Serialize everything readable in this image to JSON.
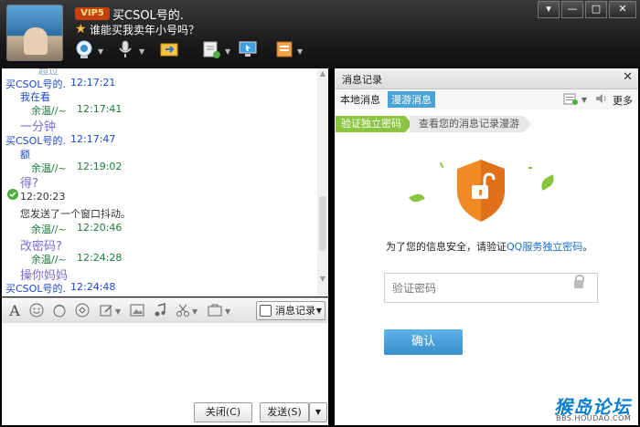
{
  "header": {
    "vip_badge": "VIP5",
    "nickname": "买CSOL号的.",
    "signature": "谁能买我卖年小号吗？"
  },
  "toolbar": {
    "icons": [
      "video-call-icon",
      "voice-call-icon",
      "file-transfer-icon",
      "message-icon",
      "remote-assist-icon",
      "app-box-icon"
    ]
  },
  "window_controls": {
    "menu": "▾",
    "minimize": "—",
    "maximize": "□",
    "close": "✕"
  },
  "chat": {
    "messages": [
      {
        "sender": "买CSOL号的.",
        "time": "12:17:21",
        "text": "我在看"
      },
      {
        "sender": "余温//~",
        "time": "12:17:41",
        "text": "一分钟"
      },
      {
        "sender": "买CSOL号的.",
        "time": "12:17:47",
        "text": "额"
      },
      {
        "sender": "余温//~",
        "time": "12:19:02",
        "text": "得?"
      },
      {
        "system_time": "12:20:23",
        "system_text": "您发送了一个窗口抖动。"
      },
      {
        "sender": "余温//~",
        "time": "12:20:46",
        "text": "改密码?"
      },
      {
        "sender": "余温//~",
        "time": "12:24:28",
        "text": "操你妈妈"
      },
      {
        "sender": "买CSOL号的.",
        "time": "12:24:48",
        "text": ""
      }
    ],
    "cut_off_top": "超过"
  },
  "input_toolbar": {
    "history_label": "消息记录"
  },
  "bottom": {
    "close_label": "关闭(C)",
    "send_label": "发送(S)"
  },
  "history_panel": {
    "title": "消息记录",
    "tab_local": "本地消息",
    "tab_roaming": "漫游消息",
    "more_label": "更多",
    "step1": "验证独立密码",
    "step2": "查看您的消息记录漫游",
    "notice_prefix": "为了您的信息安全，请验证",
    "notice_link": "QQ服务独立密码",
    "notice_suffix": "。",
    "password_placeholder": "验证密码",
    "confirm_label": "确认"
  },
  "watermark": {
    "main": "猴岛论坛",
    "sub": "BBS.HOUDAO.COM"
  },
  "colors": {
    "accent_blue": "#4aa3d6",
    "step_green": "#8bc53f",
    "shield_orange": "#f08a24",
    "sender_blue": "#1a48c7",
    "sender_green": "#1a7c3a",
    "message_purple": "#7a6ad4"
  }
}
